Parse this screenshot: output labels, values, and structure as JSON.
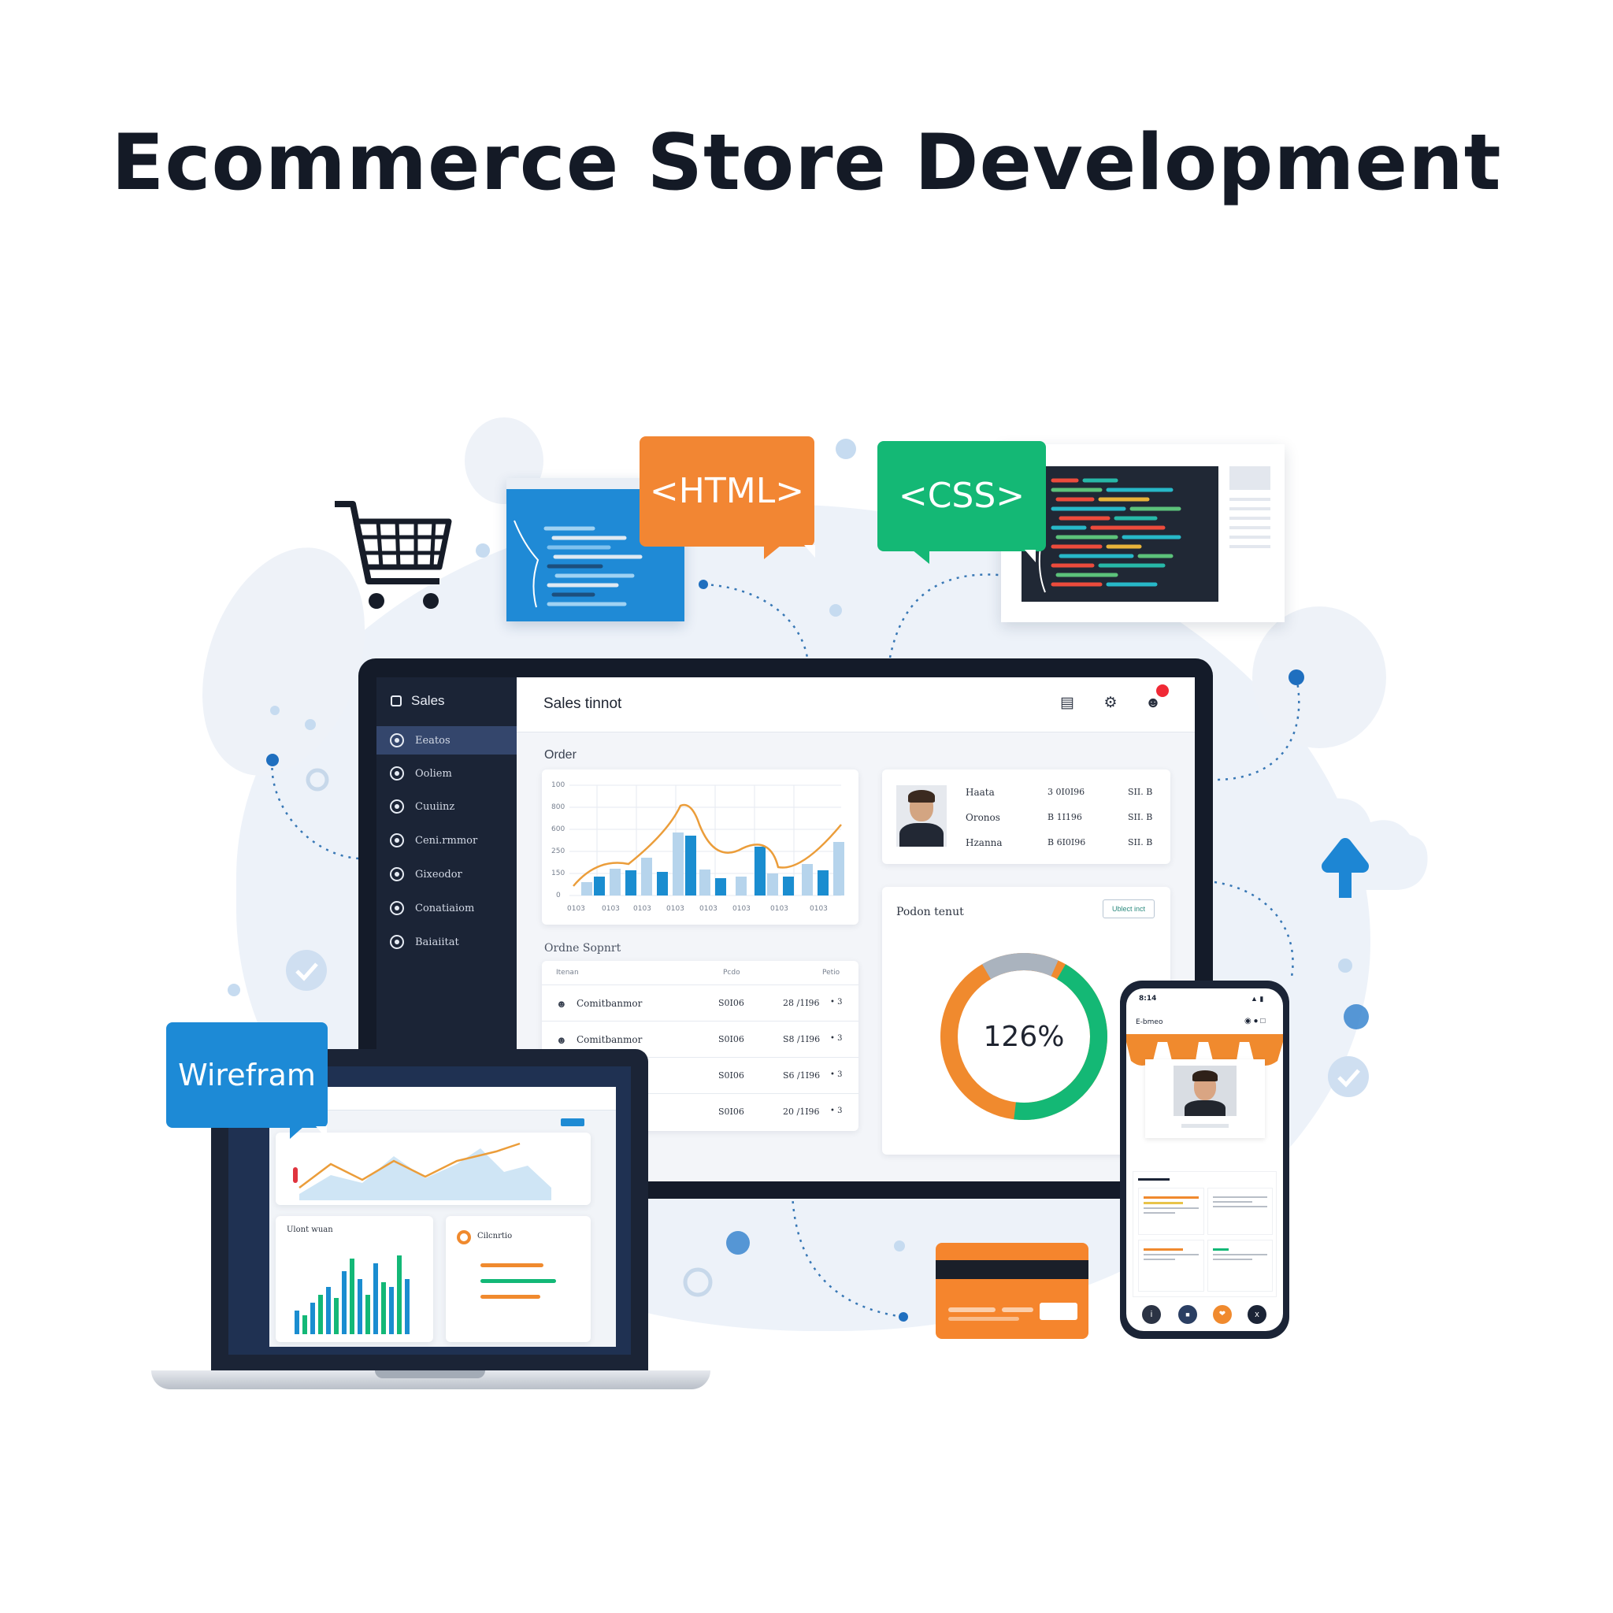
{
  "title": "Ecommerce Store Development",
  "bubbles": {
    "html": "<HTML>",
    "css": "<CSS>",
    "wireframe": "Wirefram"
  },
  "dashboard": {
    "sidebar_header": "Sales",
    "sidebar_items": [
      "Eeatos",
      "Ooliem",
      "Cuuiinz",
      "Ceni.rmmor",
      "Gixeodor",
      "Conatiaiom",
      "Baiaiitat"
    ],
    "topbar_title": "Sales tinnot",
    "section_order": "Order",
    "section_orders_table": "Ordne Sopnrt",
    "orders_table_headers": [
      "Itenan",
      "Pcdo",
      "Petio"
    ],
    "orders_rows": [
      {
        "name": "Comitbanmor",
        "id": "S0I06",
        "val": "28 /1I96",
        "mark": "• 3"
      },
      {
        "name": "Comitbanmor",
        "id": "S0I06",
        "val": "S8 /1I96",
        "mark": "• 3"
      },
      {
        "name": "",
        "id": "S0I06",
        "val": "S6 /1I96",
        "mark": "• 3"
      },
      {
        "name": "",
        "id": "S0I06",
        "val": "20 /1I96",
        "mark": "• 3"
      }
    ],
    "chart_y_ticks": [
      "100",
      "800",
      "600",
      "250",
      "150",
      "0"
    ],
    "chart_x_ticks": [
      "0103",
      "0103",
      "0103",
      "0103",
      "0103",
      "0103",
      "0103",
      "0103"
    ],
    "customer_rows": [
      {
        "name": "Haata",
        "val": "3 0I0I96",
        "tail": "SII. B"
      },
      {
        "name": "Oronos",
        "val": "B 1I196",
        "tail": "SII. B"
      },
      {
        "name": "Hzanna",
        "val": "B 6I0I96",
        "tail": "SII. B"
      }
    ],
    "product_card_title": "Podon tenut",
    "product_card_button": "Ublect inct",
    "donut_value": "126%"
  },
  "laptop": {
    "card_left_title": "Ulont wuan",
    "card_right_title": "Cilcnrtio"
  },
  "phone": {
    "status_left": "8:14",
    "header_left": "E-bmeo",
    "bottom_icons": [
      "i",
      "■",
      "❤",
      "x"
    ]
  },
  "colors": {
    "navy": "#141b29",
    "blue": "#1c8fd6",
    "orange": "#f2832b",
    "green": "#13b877",
    "bar_light": "#b6d4ec",
    "line": "#eb9d3a"
  }
}
